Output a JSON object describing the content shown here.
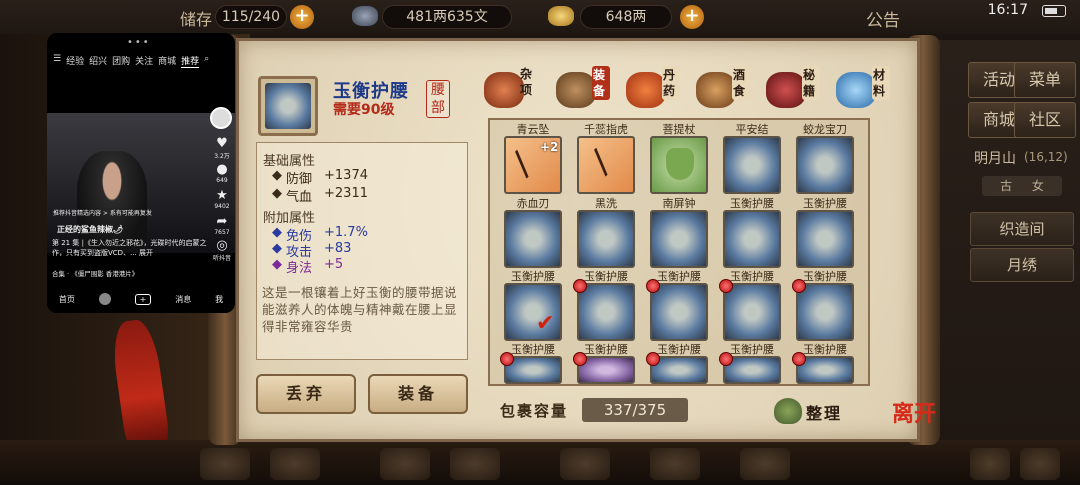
{
  "topbar": {
    "storage_label": "储存",
    "storage_value": "115/240",
    "money_value": "481两635文",
    "silver_value": "648两",
    "notice_label": "公告",
    "time": "16:17"
  },
  "right_panel": {
    "buttons": [
      "活动",
      "菜单",
      "商城",
      "社区"
    ],
    "location": "明月山",
    "coords": "(16,12)",
    "chip": "古",
    "sub_chip": "女",
    "quest_1": "织造间",
    "quest_2": "月绣"
  },
  "item": {
    "name": "玉衡护腰",
    "level_req": "需要90级",
    "slot": "腰部",
    "base_title": "基础属性",
    "base_stats": [
      {
        "name": "防御",
        "value": "+1374"
      },
      {
        "name": "气血",
        "value": "+2311"
      }
    ],
    "extra_title": "附加属性",
    "extra_stats": [
      {
        "name": "免伤",
        "value": "+1.7%"
      },
      {
        "name": "攻击",
        "value": "+83"
      },
      {
        "name": "身法",
        "value": "+5"
      }
    ],
    "description": "这是一根镶着上好玉衡的腰带据说能滋养人的体魄与精神戴在腰上显得非常雍容华贵"
  },
  "actions": {
    "discard": "丢弃",
    "equip": "装备"
  },
  "categories": [
    {
      "label": "杂项",
      "icon": "jar-icon",
      "color": "#b04a20"
    },
    {
      "label": "装备",
      "icon": "weapon-icon",
      "color": "#7a4a2a",
      "active": true
    },
    {
      "label": "丹药",
      "icon": "pill-icon",
      "color": "#d85a30"
    },
    {
      "label": "酒食",
      "icon": "wine-icon",
      "color": "#8a5a30"
    },
    {
      "label": "秘籍",
      "icon": "book-icon",
      "color": "#a03030"
    },
    {
      "label": "材料",
      "icon": "crystal-icon",
      "color": "#4a8ac8"
    }
  ],
  "inventory": {
    "rows": [
      [
        {
          "top_label": "青云坠",
          "name": "赤血刃",
          "kind": "orange",
          "plus": "+2"
        },
        {
          "top_label": "千蕊指虎",
          "name": "黑洗",
          "kind": "orange"
        },
        {
          "top_label": "菩提杖",
          "name": "南屏钟",
          "kind": "green"
        },
        {
          "top_label": "平安结",
          "name": "玉衡护腰",
          "kind": "helmet"
        },
        {
          "top_label": "蛟龙宝刀",
          "name": "玉衡护腰",
          "kind": "helmet"
        }
      ],
      [
        {
          "name": "玉衡护腰",
          "kind": "helmet"
        },
        {
          "name": "玉衡护腰",
          "kind": "helmet"
        },
        {
          "name": "玉衡护腰",
          "kind": "helmet"
        },
        {
          "name": "玉衡护腰",
          "kind": "helmet"
        },
        {
          "name": "玉衡护腰",
          "kind": "helmet"
        }
      ],
      [
        {
          "name": "玉衡护腰",
          "kind": "helmet",
          "selected": true
        },
        {
          "name": "玉衡护腰",
          "kind": "helmet",
          "dot": true
        },
        {
          "name": "玉衡护腰",
          "kind": "helmet",
          "dot": true
        },
        {
          "name": "玉衡护腰",
          "kind": "helmet",
          "dot": true
        },
        {
          "name": "玉衡护腰",
          "kind": "helmet",
          "dot": true
        }
      ]
    ]
  },
  "capacity": {
    "label": "包裹容量",
    "value": "337/375"
  },
  "sort_label": "整理",
  "leave_label": "离开",
  "phone": {
    "nav": [
      "经验",
      "绍兴",
      "团购",
      "关注",
      "商城",
      "推荐"
    ],
    "likes": "3.2万",
    "comments": "649",
    "favs": "9402",
    "shares": "7657",
    "listen": "听抖音",
    "banner": "推荐抖音精选内容 > 系有可能再复发",
    "title": "正经的鲨鱼辣椒🌶",
    "caption": "第 21 集 |《生入勿近之邪花》，光碟时代的启蒙之作，只有买到盗版VCD、... 展开",
    "collection": "合集 · 《僵尸围影 香港港片》",
    "bottom": [
      "首页",
      "",
      "+",
      "消息",
      "我"
    ]
  }
}
